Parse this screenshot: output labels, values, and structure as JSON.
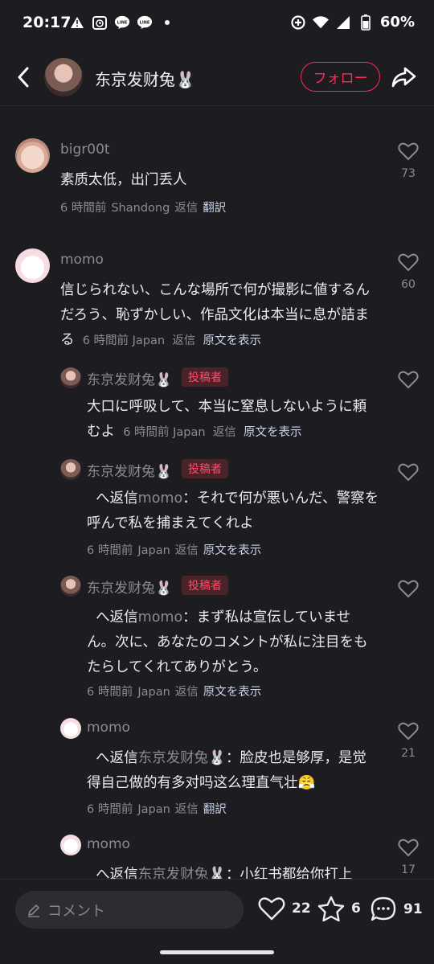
{
  "status_bar": {
    "time": "20:17",
    "battery": "60%",
    "icons": [
      "warning-icon",
      "alarm-icon",
      "line-icon",
      "line-icon",
      "dot-icon",
      "data-saver-icon",
      "wifi-icon",
      "signal-icon",
      "battery-icon"
    ]
  },
  "header": {
    "name": "东京发财兔🐰",
    "follow_label": "フォロー"
  },
  "comments": [
    {
      "user": "bigr00t",
      "text": "素质太低，出门丢人",
      "time": "6 時間前",
      "location": "Shandong",
      "reply": "返信",
      "translate": "翻訳",
      "likes": "73"
    },
    {
      "user": "momo",
      "text": "信じられない、こんな場所で何が撮影に値するんだろう、恥ずかしい、作品文化は本当に息が詰まる",
      "time": "6 時間前",
      "location": "Japan",
      "reply": "返信",
      "translate": "原文を表示",
      "likes": "60"
    }
  ],
  "replies": [
    {
      "user": "东京发财兔🐰",
      "badge": "投稿者",
      "text": "大口に呼吸して、本当に窒息しないように頼むよ",
      "time": "6 時間前",
      "location": "Japan",
      "reply": "返信",
      "translate": "原文を表示",
      "likes": ""
    },
    {
      "user": "东京发财兔🐰",
      "badge": "投稿者",
      "reply_prefix": "へ返信",
      "reply_to": "momo",
      "text": "：それで何が悪いんだ、警察を呼んで私を捕まえてくれよ",
      "time": "6 時間前",
      "location": "Japan",
      "reply": "返信",
      "translate": "原文を表示",
      "likes": ""
    },
    {
      "user": "东京发财兔🐰",
      "badge": "投稿者",
      "reply_prefix": "へ返信",
      "reply_to": "momo",
      "text": "：まず私は宣伝していません。次に、あなたのコメントが私に注目をもたらしてくれてありがとう。",
      "time": "6 時間前",
      "location": "Japan",
      "reply": "返信",
      "translate": "原文を表示",
      "likes": ""
    },
    {
      "user": "momo",
      "badge": "",
      "reply_prefix": "へ返信",
      "reply_to": "东京发财兔🐰",
      "text": "：脸皮也是够厚，是觉得自己做的有多对吗这么理直气壮😤",
      "time": "6 時間前",
      "location": "Japan",
      "reply": "返信",
      "translate": "翻訳",
      "likes": "21"
    },
    {
      "user": "momo",
      "badge": "",
      "reply_prefix": "へ返信",
      "reply_to": "东京发财兔🐰",
      "text": "：小红书都给你打上",
      "likes": "17"
    }
  ],
  "bottom_bar": {
    "comment_placeholder": "コメント",
    "likes": "22",
    "favorites": "6",
    "comments": "91"
  },
  "colors": {
    "background": "#1c1c21",
    "accent": "#fe2c55",
    "muted": "#8b8b94"
  }
}
